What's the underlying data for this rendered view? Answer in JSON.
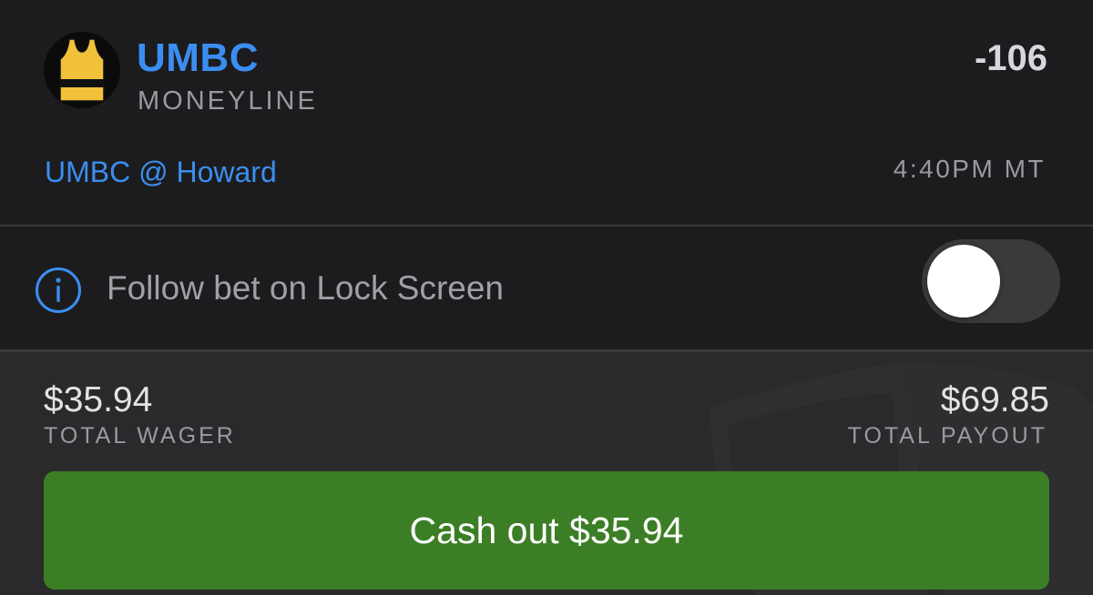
{
  "bet": {
    "team": "UMBC",
    "market": "MONEYLINE",
    "odds": "-106",
    "matchup": "UMBC @ Howard",
    "time": "4:40PM MT",
    "jersey_icon": "basketball-jersey-icon",
    "colors": {
      "team_link": "#3b8ef0",
      "jersey_primary": "#f2c13a",
      "jersey_stripe": "#111111"
    }
  },
  "follow": {
    "label": "Follow bet on Lock Screen",
    "info_icon": "info-icon",
    "toggle_on": false
  },
  "wager": {
    "amount": "$35.94",
    "label": "TOTAL WAGER"
  },
  "payout": {
    "amount": "$69.85",
    "label": "TOTAL PAYOUT"
  },
  "cashout": {
    "label": "Cash out $35.94",
    "color": "#3c7e25"
  }
}
